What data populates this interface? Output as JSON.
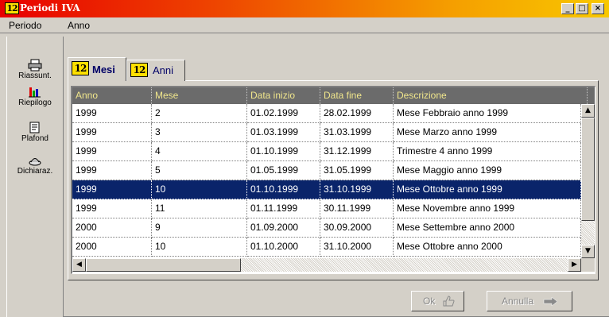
{
  "window": {
    "title": "Periodi IVA",
    "icon_text": "12",
    "minimize": "_",
    "maximize": "□",
    "close": "×"
  },
  "menu": [
    "Periodo",
    "Anno"
  ],
  "sidebar": [
    {
      "label": "Riassunt.",
      "icon": "printer-icon"
    },
    {
      "label": "Riepilogo",
      "icon": "chart-icon"
    },
    {
      "label": "Plafond",
      "icon": "document-icon"
    },
    {
      "label": "Dichiaraz.",
      "icon": "dish-icon"
    }
  ],
  "tabs": [
    {
      "label": "Mesi",
      "icon_text": "12",
      "active": true
    },
    {
      "label": "Anni",
      "icon_text": "12",
      "active": false
    }
  ],
  "table": {
    "columns": [
      "Anno",
      "Mese",
      "Data inizio",
      "Data fine",
      "Descrizione"
    ],
    "rows": [
      [
        "1999",
        "2",
        "01.02.1999",
        "28.02.1999",
        "Mese  Febbraio anno 1999"
      ],
      [
        "1999",
        "3",
        "01.03.1999",
        "31.03.1999",
        "Mese  Marzo anno 1999"
      ],
      [
        "1999",
        "4",
        "01.10.1999",
        "31.12.1999",
        "Trimestre 4 anno 1999"
      ],
      [
        "1999",
        "5",
        "01.05.1999",
        "31.05.1999",
        "Mese  Maggio anno 1999"
      ],
      [
        "1999",
        "10",
        "01.10.1999",
        "31.10.1999",
        "Mese  Ottobre anno 1999"
      ],
      [
        "1999",
        "11",
        "01.11.1999",
        "30.11.1999",
        "Mese  Novembre anno 1999"
      ],
      [
        "2000",
        "9",
        "01.09.2000",
        "30.09.2000",
        "Mese  Settembre anno 2000"
      ],
      [
        "2000",
        "10",
        "01.10.2000",
        "31.10.2000",
        "Mese  Ottobre anno 2000"
      ]
    ],
    "selected_row_number": 5
  },
  "buttons": {
    "ok": "Ok",
    "cancel": "Annulla"
  },
  "colors": {
    "selection": "#0a246a",
    "header_bg": "#6b6b6b",
    "header_text": "#f0e68c",
    "title_gradient_start": "#e80000",
    "title_gradient_end": "#f8c800"
  }
}
